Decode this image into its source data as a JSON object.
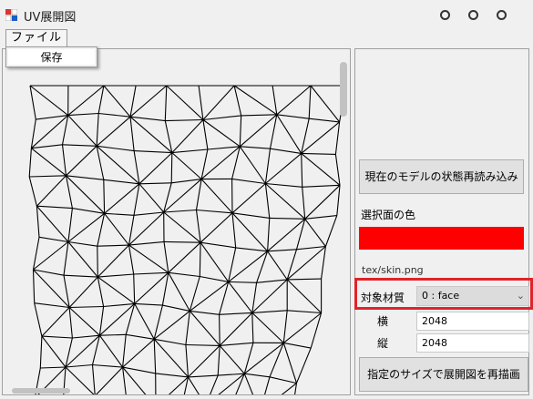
{
  "window": {
    "title": "UV展開図",
    "controls": [
      "minimize-icon",
      "maximize-icon",
      "close-icon"
    ]
  },
  "menu": {
    "file_label": "ファイル",
    "file_items": [
      {
        "label": "保存"
      }
    ]
  },
  "panel": {
    "reload_button": "現在のモデルの状態再読み込み",
    "selected_face_color_label": "選択面の色",
    "selected_face_color": "#ff0000",
    "texture_path": "tex/skin.png",
    "material_label": "対象材質",
    "material_value": "0 : face",
    "width_label": "横",
    "width_value": "2048",
    "height_label": "縦",
    "height_value": "2048",
    "redraw_button": "指定のサイズで展開図を再描画"
  },
  "colors": {
    "background": "#f0f0f0",
    "highlight": "#e0232b",
    "mesh_stroke": "#000000"
  }
}
